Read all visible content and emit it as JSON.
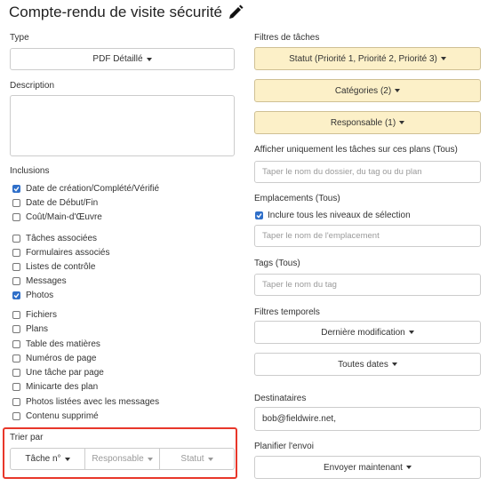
{
  "title": "Compte-rendu de visite sécurité",
  "left": {
    "type_label": "Type",
    "type_value": "PDF Détaillé",
    "description_label": "Description",
    "inclusions_label": "Inclusions",
    "inclusions": [
      {
        "label": "Date de création/Complété/Vérifié",
        "checked": true
      },
      {
        "label": "Date de Début/Fin",
        "checked": false
      },
      {
        "label": "Coût/Main-d'Œuvre",
        "checked": false
      },
      {
        "label": "Tâches associées",
        "checked": false
      },
      {
        "label": "Formulaires associés",
        "checked": false
      },
      {
        "label": "Listes de contrôle",
        "checked": false
      },
      {
        "label": "Messages",
        "checked": false
      },
      {
        "label": "Photos",
        "checked": true
      },
      {
        "label": "Fichiers",
        "checked": false
      },
      {
        "label": "Plans",
        "checked": false
      },
      {
        "label": "Table des matières",
        "checked": false
      },
      {
        "label": "Numéros de page",
        "checked": false
      },
      {
        "label": "Une tâche par page",
        "checked": false
      },
      {
        "label": "Minicarte des plan",
        "checked": false
      },
      {
        "label": "Photos listées avec les messages",
        "checked": false
      },
      {
        "label": "Contenu supprimé",
        "checked": false
      }
    ],
    "sort_label": "Trier par",
    "sort_options": [
      "Tâche n°",
      "Responsable",
      "Statut"
    ]
  },
  "right": {
    "filters_label": "Filtres de tâches",
    "status_filter": "Statut (Priorité 1, Priorité 2, Priorité 3)",
    "categories_filter": "Catégories (2)",
    "responsible_filter": "Responsable (1)",
    "plans_label": "Afficher uniquement les tâches sur ces plans (Tous)",
    "plans_placeholder": "Taper le nom du dossier, du tag ou du plan",
    "locations_label": "Emplacements (Tous)",
    "include_levels_label": "Inclure tous les niveaux de sélection",
    "include_levels_checked": true,
    "location_placeholder": "Taper le nom de l'emplacement",
    "tags_label": "Tags (Tous)",
    "tags_placeholder": "Taper le nom du tag",
    "time_filters_label": "Filtres temporels",
    "last_modified": "Dernière modification",
    "all_dates": "Toutes dates",
    "recipients_label": "Destinataires",
    "recipients_value": "bob@fieldwire.net,",
    "schedule_label": "Planifier l'envoi",
    "send_now": "Envoyer maintenant"
  },
  "colors": {
    "accent_yellow": "#fcf0c8",
    "checkbox_blue": "#2f6fc9",
    "highlight_red": "#e8372a"
  }
}
